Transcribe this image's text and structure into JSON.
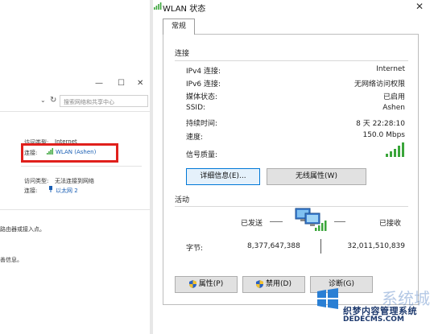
{
  "background_window": {
    "search_placeholder": "搜索网络和共享中心",
    "conn1": {
      "access_label": "访问类型:",
      "access_value": "Internet",
      "conn_label": "连接:",
      "conn_value": "WLAN (Ashen)"
    },
    "conn2": {
      "access_label": "访问类型:",
      "access_value": "无法连接到网络",
      "conn_label": "连接:",
      "conn_value": "以太网 2"
    },
    "text_line1": "路由器或接入点。",
    "text_line2": "善信息。"
  },
  "dialog": {
    "title": "WLAN 状态",
    "close": "✕",
    "tab_general": "常规",
    "section_connection": "连接",
    "rows": [
      {
        "label": "IPv4 连接:",
        "value": "Internet"
      },
      {
        "label": "IPv6 连接:",
        "value": "无网络访问权限"
      },
      {
        "label": "媒体状态:",
        "value": "已启用"
      },
      {
        "label": "SSID:",
        "value": "Ashen"
      },
      {
        "label": "持续时间:",
        "value": "8 天 22:28:10"
      },
      {
        "label": "速度:",
        "value": "150.0 Mbps"
      }
    ],
    "signal_label": "信号质量:",
    "signal_bars": 5,
    "details_button": "详细信息(E)...",
    "wireless_props_button": "无线属性(W)",
    "section_activity": "活动",
    "sent_label": "已发送",
    "received_label": "已接收",
    "bytes_label": "字节:",
    "bytes_sent": "8,377,647,388",
    "bytes_received": "32,011,510,839",
    "properties_button": "属性(P)",
    "disable_button": "禁用(D)",
    "diagnose_button": "诊断(G)"
  },
  "watermark": {
    "brand": "系统城",
    "line1": "织梦内容管理系统",
    "line2": "DEDECMS.COM"
  },
  "colors": {
    "highlight_box": "#e0201c",
    "signal_green": "#3aa53a",
    "link_blue": "#1a5fb4"
  }
}
